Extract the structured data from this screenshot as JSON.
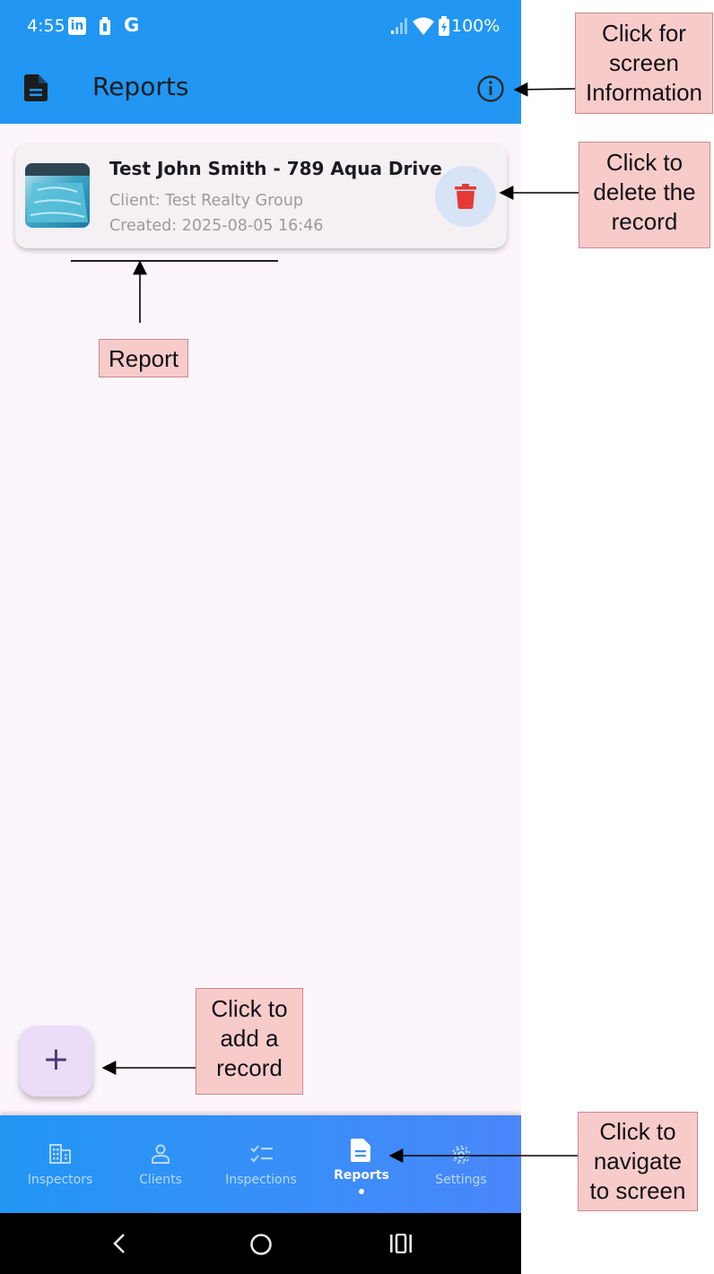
{
  "status_bar": {
    "time": "4:55",
    "linkedin_badge": "in",
    "google_badge": "G",
    "battery": "100%"
  },
  "app_bar": {
    "title": "Reports",
    "leading_icon": "document-icon",
    "action_icon": "info-icon"
  },
  "report": {
    "title": "Test John Smith - 789 Aqua Drive",
    "client": "Client: Test Realty Group",
    "created": "Created: 2025-08-05 16:46",
    "thumbnail": "pool-photo",
    "delete_icon": "trash-icon"
  },
  "fab": {
    "label": "+"
  },
  "bottom_nav": {
    "items": [
      {
        "label": "Inspectors",
        "icon": "building-icon",
        "active": false
      },
      {
        "label": "Clients",
        "icon": "person-icon",
        "active": false
      },
      {
        "label": "Inspections",
        "icon": "checklist-icon",
        "active": false
      },
      {
        "label": "Reports",
        "icon": "document-icon",
        "active": true
      },
      {
        "label": "Settings",
        "icon": "gear-icon",
        "active": false
      }
    ]
  },
  "annotations": {
    "info": [
      "Click for",
      "screen",
      "Information"
    ],
    "delete": [
      "Click to",
      "delete the",
      "record"
    ],
    "report": [
      "Report"
    ],
    "add": [
      "Click to",
      "add a",
      "record"
    ],
    "navigate": [
      "Click to",
      "navigate",
      "to screen"
    ]
  },
  "colors": {
    "app_bar": "#2196f3",
    "background": "#fdf5fc",
    "delete": "#e53935",
    "callout": "#f8cbcb"
  }
}
